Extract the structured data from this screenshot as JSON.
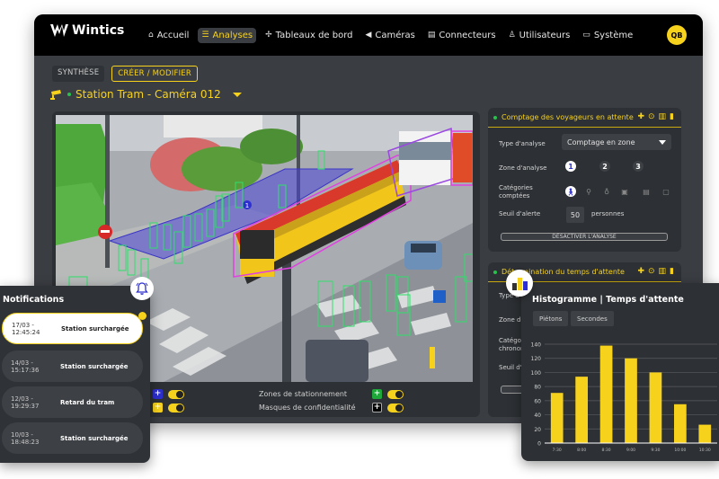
{
  "app": {
    "brand": "Wintics",
    "user_initials": "QB",
    "accent_color": "#f7d21d"
  },
  "nav": {
    "items": [
      {
        "label": "Accueil",
        "icon": "home-icon",
        "active": false
      },
      {
        "label": "Analyses",
        "icon": "database-stack-icon",
        "active": true
      },
      {
        "label": "Tableaux de bord",
        "icon": "move-cross-icon",
        "active": false
      },
      {
        "label": "Caméras",
        "icon": "camera-icon",
        "active": false
      },
      {
        "label": "Connecteurs",
        "icon": "database-icon",
        "active": false
      },
      {
        "label": "Utilisateurs",
        "icon": "user-icon",
        "active": false
      },
      {
        "label": "Système",
        "icon": "monitor-icon",
        "active": false
      }
    ]
  },
  "subtabs": [
    {
      "label": "SYNTHÈSE",
      "active": false
    },
    {
      "label": "CRÉER / MODIFIER",
      "active": true
    }
  ],
  "camera": {
    "name": "Station Tram - Caméra 012",
    "status": "online",
    "zone_marker": "1"
  },
  "feed_controls": {
    "rows": [
      {
        "label": "Zones de stationnement",
        "left_color": "#2d2fcf",
        "right_color": "#1fa83a",
        "left_on": true,
        "right_on": true
      },
      {
        "label": "Masques de confidentialité",
        "left_color": "#f7d21d",
        "right_color": "#000000",
        "left_on": true,
        "right_on": true
      }
    ]
  },
  "analysis_cards": [
    {
      "title": "Comptage des voyageurs en attente",
      "fields": {
        "type_label": "Type d'analyse",
        "type_value": "Comptage en zone",
        "zone_label": "Zone d'analyse",
        "zones": [
          "1",
          "2",
          "3"
        ],
        "active_zone": "1",
        "categories_label": "Catégories comptées",
        "categories": [
          "pedestrian-icon",
          "bicycle-icon",
          "scooter-icon",
          "tram-icon",
          "bus-icon",
          "train-icon"
        ],
        "active_category": "pedestrian-icon",
        "threshold_label": "Seuil d'alerte",
        "threshold_value": "50",
        "threshold_unit": "personnes",
        "deactivate_label": "DÉSACTIVER L'ANALYSE"
      }
    },
    {
      "title": "Détermination du temps d'attente",
      "fields": {
        "type_label": "Type d'analyse",
        "zone_label": "Zone d'analyse",
        "categories_label": "Catégories chronométrées",
        "threshold_label": "Seuil d'alerte"
      }
    }
  ],
  "notifications": {
    "title": "Notifications",
    "items": [
      {
        "timestamp": "17/03 - 12:45:24",
        "message": "Station surchargée",
        "active": true
      },
      {
        "timestamp": "14/03 - 15:17:36",
        "message": "Station surchargée",
        "active": false
      },
      {
        "timestamp": "12/03 - 19:29:37",
        "message": "Retard du tram",
        "active": false
      },
      {
        "timestamp": "10/03 - 18:48:23",
        "message": "Station surchargée",
        "active": false
      }
    ]
  },
  "histogram": {
    "title": "Histogramme |  Temps d'attente",
    "chips": [
      "Piétons",
      "Secondes"
    ]
  },
  "chart_data": {
    "type": "bar",
    "title": "Histogramme | Temps d'attente",
    "categories": [
      "7:30",
      "8:00",
      "8:30",
      "9:00",
      "9:30",
      "10:00",
      "10:30"
    ],
    "values": [
      71,
      94,
      138,
      120,
      100,
      55,
      26
    ],
    "xlabel": "",
    "ylabel": "",
    "ylim": [
      0,
      140
    ],
    "yticks": [
      0,
      20,
      40,
      60,
      80,
      100,
      120,
      140
    ],
    "grid": true,
    "bar_color": "#f7d21d"
  }
}
